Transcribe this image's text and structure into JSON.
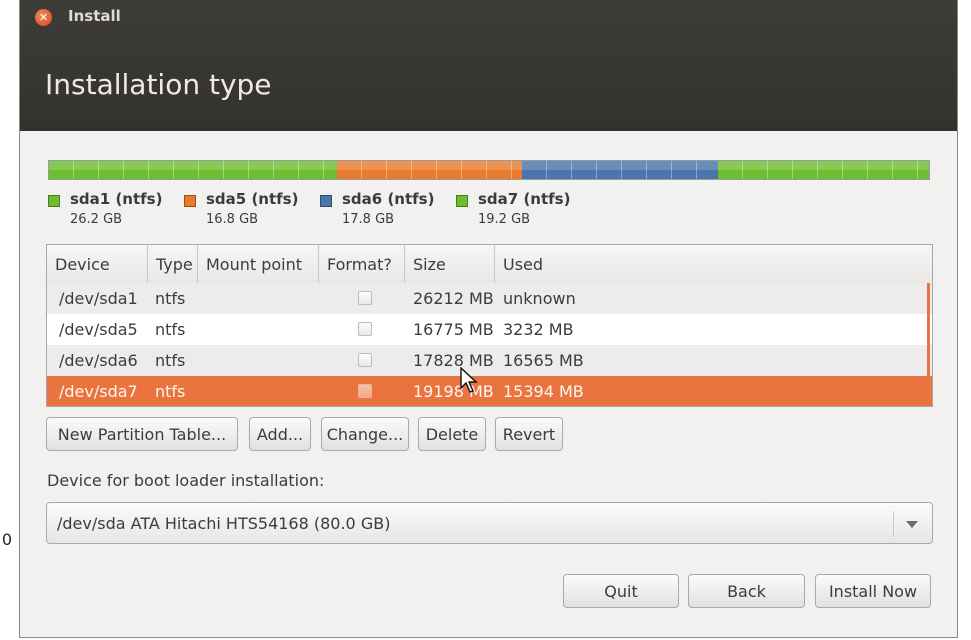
{
  "edge_text": "0",
  "window": {
    "title": "Install",
    "heading": "Installation type"
  },
  "partitions": [
    {
      "name": "sda1 (ntfs)",
      "size": "26.2 GB",
      "color": "#6cbe2f",
      "fraction": 0.3275
    },
    {
      "name": "sda5 (ntfs)",
      "size": "16.8 GB",
      "color": "#ea7a2c",
      "fraction": 0.21
    },
    {
      "name": "sda6 (ntfs)",
      "size": "17.8 GB",
      "color": "#4a76ab",
      "fraction": 0.2225
    },
    {
      "name": "sda7 (ntfs)",
      "size": "19.2 GB",
      "color": "#6cbe2f",
      "fraction": 0.24
    }
  ],
  "table": {
    "headers": [
      "Device",
      "Type",
      "Mount point",
      "Format?",
      "Size",
      "Used"
    ],
    "rows": [
      {
        "device": "/dev/sda1",
        "type": "ntfs",
        "mount": "",
        "format": false,
        "size": "26212 MB",
        "used": "unknown"
      },
      {
        "device": "/dev/sda5",
        "type": "ntfs",
        "mount": "",
        "format": false,
        "size": "16775 MB",
        "used": "3232 MB"
      },
      {
        "device": "/dev/sda6",
        "type": "ntfs",
        "mount": "",
        "format": false,
        "size": "17828 MB",
        "used": "16565 MB"
      },
      {
        "device": "/dev/sda7",
        "type": "ntfs",
        "mount": "",
        "format": false,
        "size": "19198 MB",
        "used": "15394 MB",
        "selected": true
      }
    ]
  },
  "buttons": {
    "new_table": "New Partition Table...",
    "add": "Add...",
    "change": "Change...",
    "delete": "Delete",
    "revert": "Revert"
  },
  "bootloader": {
    "label": "Device for boot loader installation:",
    "value": "/dev/sda   ATA Hitachi HTS54168 (80.0 GB)"
  },
  "footer": {
    "quit": "Quit",
    "back": "Back",
    "install": "Install Now"
  },
  "colors": {
    "accent": "#e9743f",
    "header_bg": "#3c3b37"
  }
}
